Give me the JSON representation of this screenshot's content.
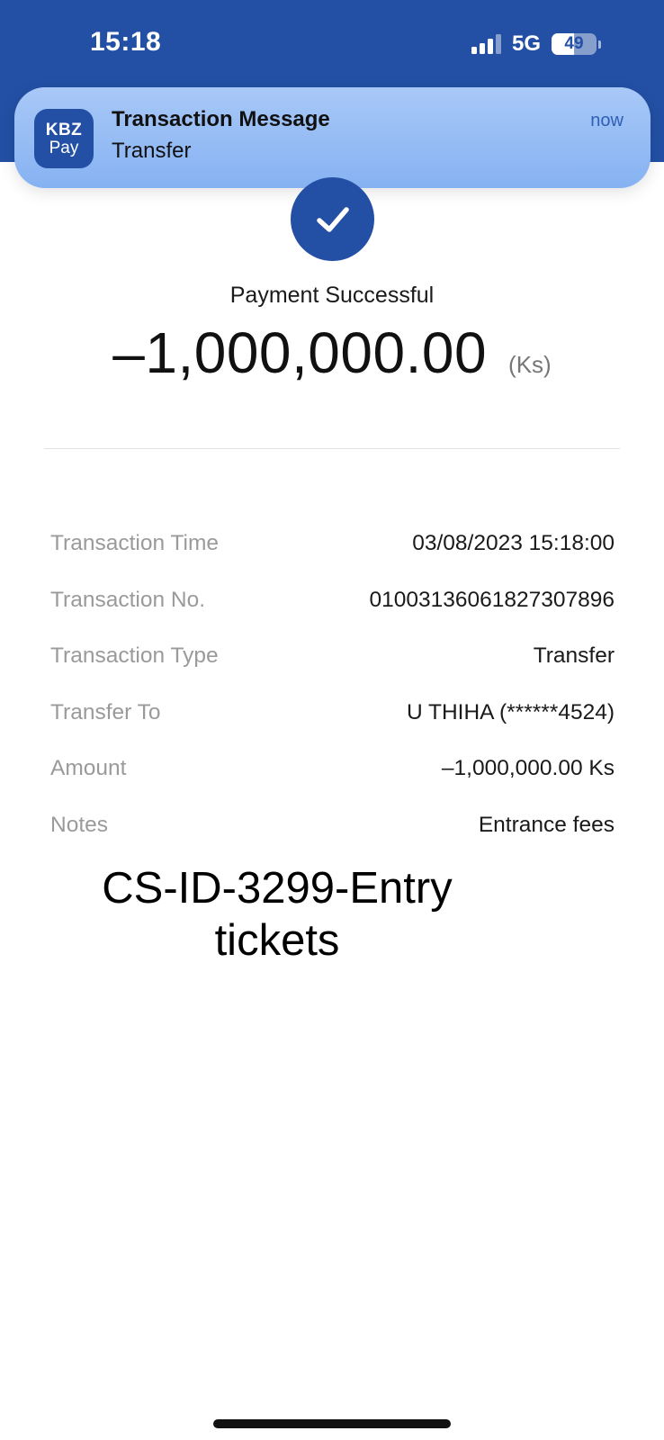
{
  "status_bar": {
    "time": "15:18",
    "network": "5G",
    "battery": "49",
    "battery_level": 0.49
  },
  "notification": {
    "app_icon_line1": "KBZ",
    "app_icon_line2": "Pay",
    "title": "Transaction Message",
    "body": "Transfer",
    "time": "now"
  },
  "receipt": {
    "status": "Payment Successful",
    "amount": "–1,000,000.00",
    "currency": "(Ks)",
    "details": [
      {
        "label": "Transaction Time",
        "value": "03/08/2023 15:18:00"
      },
      {
        "label": "Transaction No.",
        "value": "01003136061827307896"
      },
      {
        "label": "Transaction Type",
        "value": "Transfer"
      },
      {
        "label": "Transfer To",
        "value": "U THIHA (******4524)"
      },
      {
        "label": "Amount",
        "value": "–1,000,000.00 Ks"
      },
      {
        "label": "Notes",
        "value": "Entrance fees"
      }
    ]
  },
  "overlay": {
    "line1": "CS-ID-3299-Entry",
    "line2": "tickets"
  },
  "colors": {
    "brand_blue": "#2350a5",
    "notification_bg": "#96bcf5",
    "label_gray": "#9a9a9a"
  }
}
